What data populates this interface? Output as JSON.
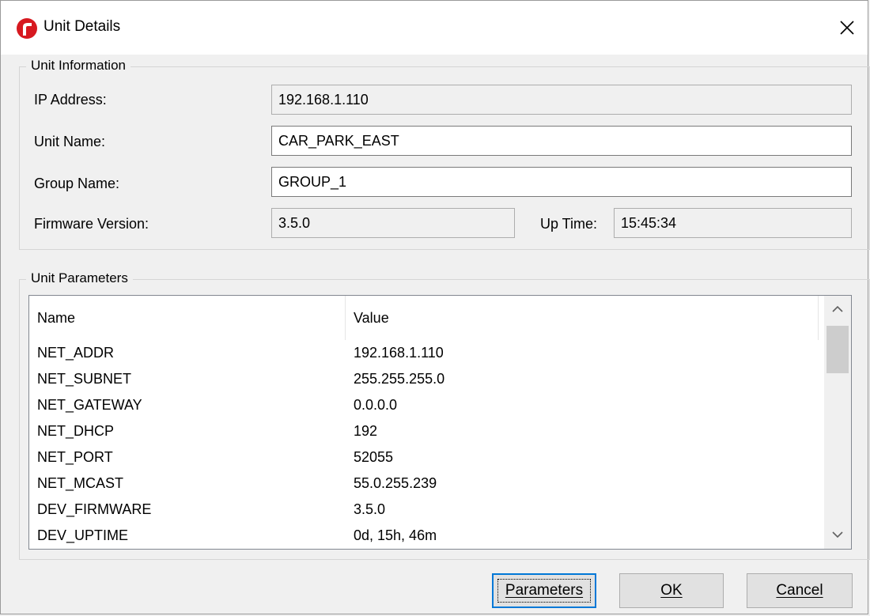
{
  "window": {
    "title": "Unit Details",
    "icon": "app-logo-icon",
    "accent": "#d71920"
  },
  "unit_information": {
    "legend": "Unit Information",
    "ip_address_label": "IP Address:",
    "ip_address_value": "192.168.1.110",
    "unit_name_label": "Unit Name:",
    "unit_name_value": "CAR_PARK_EAST",
    "group_name_label": "Group Name:",
    "group_name_value": "GROUP_1",
    "firmware_label": "Firmware Version:",
    "firmware_value": "3.5.0",
    "uptime_label": "Up Time:",
    "uptime_value": "15:45:34"
  },
  "unit_parameters": {
    "legend": "Unit Parameters",
    "columns": [
      "Name",
      "Value"
    ],
    "rows": [
      {
        "name": "NET_ADDR",
        "value": "192.168.1.110"
      },
      {
        "name": "NET_SUBNET",
        "value": "255.255.255.0"
      },
      {
        "name": "NET_GATEWAY",
        "value": "0.0.0.0"
      },
      {
        "name": "NET_DHCP",
        "value": "192"
      },
      {
        "name": "NET_PORT",
        "value": "52055"
      },
      {
        "name": "NET_MCAST",
        "value": "55.0.255.239"
      },
      {
        "name": "DEV_FIRMWARE",
        "value": "3.5.0"
      },
      {
        "name": "DEV_UPTIME",
        "value": "0d, 15h, 46m"
      }
    ]
  },
  "buttons": {
    "parameters": "Parameters",
    "ok": "OK",
    "cancel": "Cancel"
  }
}
